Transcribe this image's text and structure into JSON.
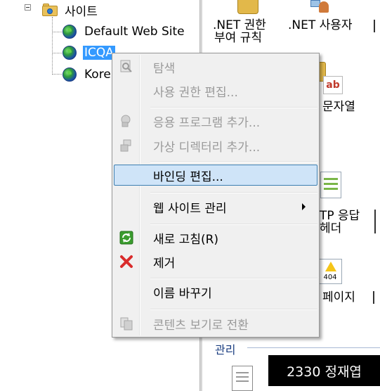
{
  "tree": {
    "root": {
      "label": "사이트"
    },
    "sites": [
      {
        "label": "Default Web Site"
      },
      {
        "label": "ICQA"
      },
      {
        "label": "Kore"
      }
    ]
  },
  "features": {
    "items": [
      {
        "label_line1": ".NET 권한",
        "label_line2": "부여 규칙"
      },
      {
        "label_line1": ".NET 사용자"
      },
      {
        "label_line1": "문자열"
      },
      {
        "label_line1": "TP 응답",
        "label_line2": "헤더"
      },
      {
        "label_line1": "페이지"
      }
    ],
    "section_title": "관리",
    "error_icon_text": "404",
    "string_icon_text": "ab"
  },
  "context_menu": {
    "items": [
      {
        "label": "탐색",
        "enabled": false,
        "icon": "explore-icon"
      },
      {
        "label": "사용 권한 편집...",
        "enabled": false
      },
      {
        "label": "응용 프로그램 추가...",
        "enabled": false,
        "icon": "add-application-icon"
      },
      {
        "label": "가상 디렉터리 추가...",
        "enabled": false,
        "icon": "add-virtual-directory-icon"
      },
      {
        "label": "바인딩 편집...",
        "enabled": true,
        "highlighted": true
      },
      {
        "label": "웹 사이트 관리",
        "enabled": true,
        "submenu": true
      },
      {
        "label": "새로 고침(R)",
        "enabled": true,
        "icon": "refresh-icon"
      },
      {
        "label": "제거",
        "enabled": true,
        "icon": "remove-icon"
      },
      {
        "label": "이름 바꾸기",
        "enabled": true
      },
      {
        "label": "콘텐츠 보기로 전환",
        "enabled": false,
        "icon": "content-view-icon"
      }
    ]
  },
  "watermark": {
    "text": "2330 정재엽"
  },
  "colors": {
    "selection": "#3399ff",
    "menu_background": "#f0f0f0",
    "menu_highlight": "#cfe4f8",
    "remove_icon": "#d92b2b",
    "refresh_icon": "#3a9c2e"
  }
}
